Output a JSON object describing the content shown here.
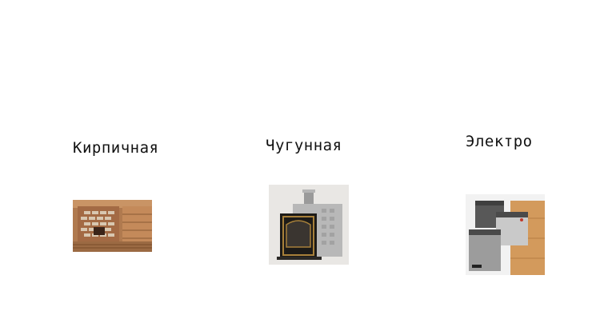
{
  "stoves": [
    {
      "title": "Кирпичная",
      "image_icon": "brick-stove-photo"
    },
    {
      "title": "Чугунная",
      "image_icon": "cast-iron-stove-photo"
    },
    {
      "title": "Электро",
      "image_icon": "electric-heater-photo"
    }
  ]
}
